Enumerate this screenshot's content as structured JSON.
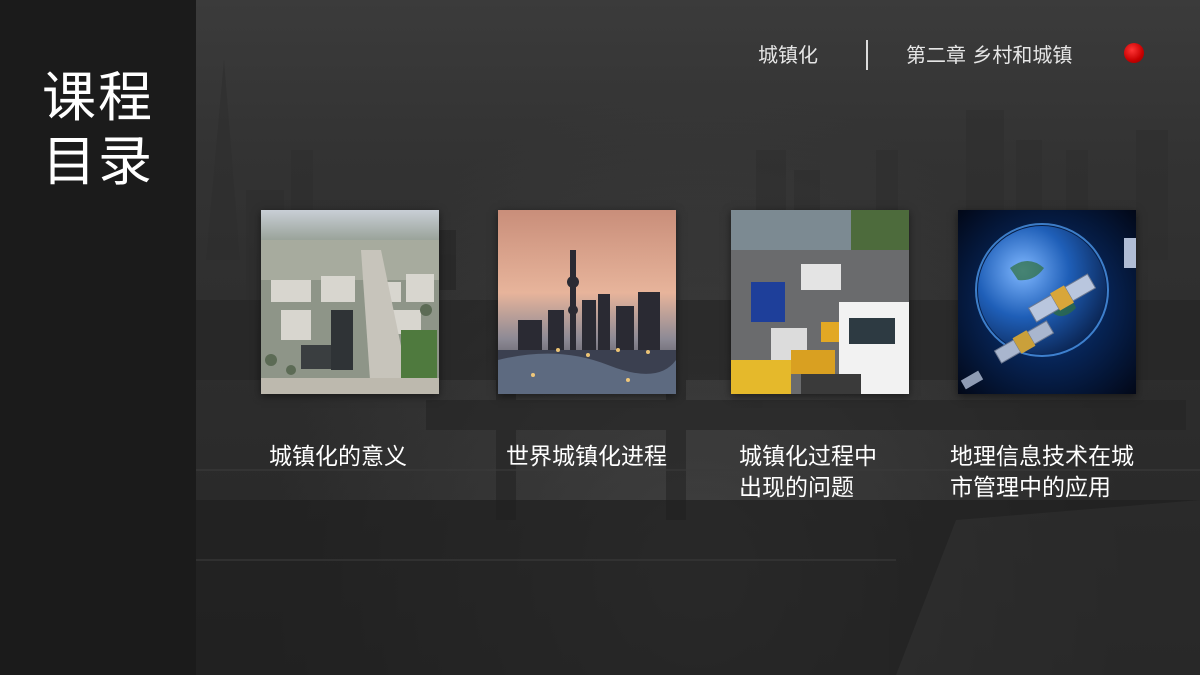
{
  "sidebar": {
    "title_line1": "课程",
    "title_line2": "目录"
  },
  "header": {
    "section": "城镇化",
    "chapter": "第二章  乡村和城镇"
  },
  "cards": [
    {
      "label": "城镇化的意义",
      "image": "aerial-city-photo"
    },
    {
      "label": "世界城镇化进程",
      "image": "skyline-dusk-photo"
    },
    {
      "label": "城镇化过程中\n出现的问题",
      "image": "traffic-jam-photo"
    },
    {
      "label": "地理信息技术在城\n市管理中的应用",
      "image": "satellite-earth-photo"
    }
  ],
  "colors": {
    "sidebar_bg": "#1b1b1b",
    "accent_dot": "#c80000",
    "text": "#ffffff"
  }
}
